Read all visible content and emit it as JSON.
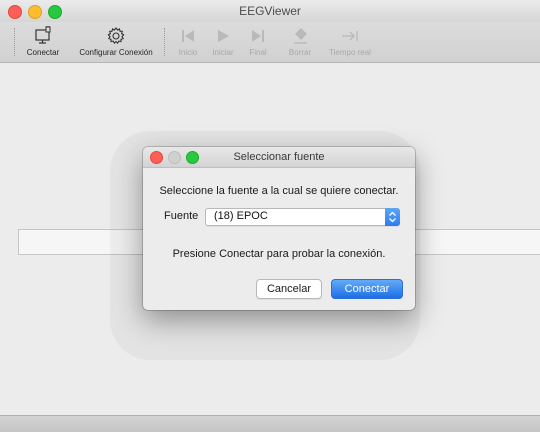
{
  "app": {
    "title": "EEGViewer"
  },
  "colors": {
    "close": "#fd5f57",
    "minimize": "#febc2e",
    "zoom": "#28c840",
    "disabled_control": "#d0d0d0",
    "accent": "#2c7cf2"
  },
  "toolbar": {
    "items": [
      {
        "label": "Conectar",
        "icon": "monitor-plug-icon",
        "enabled": true
      },
      {
        "label": "Configurar Conexión",
        "icon": "gear-icon",
        "enabled": true
      },
      {
        "label": "Inicio",
        "icon": "skip-to-start-icon",
        "enabled": false
      },
      {
        "label": "Iniciar",
        "icon": "play-icon",
        "enabled": false
      },
      {
        "label": "Final",
        "icon": "skip-to-end-icon",
        "enabled": false
      },
      {
        "label": "Borrar",
        "icon": "eraser-icon",
        "enabled": false
      },
      {
        "label": "Tiempo real",
        "icon": "arrow-to-bar-icon",
        "enabled": false
      }
    ]
  },
  "dialog": {
    "title": "Seleccionar fuente",
    "prompt": "Seleccione la fuente a la cual se quiere conectar.",
    "source_label": "Fuente",
    "source_value": "(18) EPOC",
    "hint": "Presione Conectar para probar la conexión.",
    "cancel_label": "Cancelar",
    "connect_label": "Conectar"
  }
}
